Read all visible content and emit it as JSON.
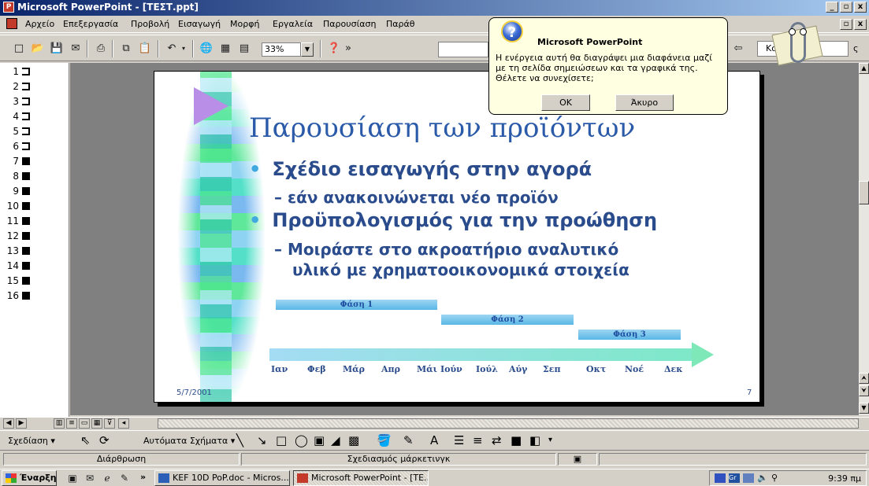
{
  "window": {
    "title": "Microsoft PowerPoint - [ΤΕΣΤ.ppt]",
    "min_btn": "_",
    "restore_btn": "▫",
    "close_btn": "x"
  },
  "menu": [
    {
      "label": "Αρχείο"
    },
    {
      "label": "Επεξεργασία"
    },
    {
      "label": "Προβολή"
    },
    {
      "label": "Εισαγωγή"
    },
    {
      "label": "Μορφή"
    },
    {
      "label": "Εργαλεία"
    },
    {
      "label": "Παρουσίαση"
    },
    {
      "label": "Παράθ"
    }
  ],
  "toolbar": {
    "zoom": "33%",
    "right_box": "Κο",
    "right_extra": "ς"
  },
  "outline": {
    "slides": [
      {
        "num": "1",
        "type": "outline"
      },
      {
        "num": "2",
        "type": "outline"
      },
      {
        "num": "3",
        "type": "outline"
      },
      {
        "num": "4",
        "type": "outline"
      },
      {
        "num": "5",
        "type": "outline"
      },
      {
        "num": "6",
        "type": "outline"
      },
      {
        "num": "7",
        "type": "filled"
      },
      {
        "num": "8",
        "type": "filled"
      },
      {
        "num": "9",
        "type": "filled"
      },
      {
        "num": "10",
        "type": "filled"
      },
      {
        "num": "11",
        "type": "filled"
      },
      {
        "num": "12",
        "type": "filled"
      },
      {
        "num": "13",
        "type": "filled"
      },
      {
        "num": "14",
        "type": "filled"
      },
      {
        "num": "15",
        "type": "filled"
      },
      {
        "num": "16",
        "type": "filled"
      }
    ]
  },
  "slide": {
    "title": "Παρουσίαση των προϊόντων",
    "bullet1": "Σχέδιο εισαγωγής στην αγορά",
    "sub1": "– εάν ανακοινώνεται νέο προϊόν",
    "bullet2": "Προϋπολογισμός για την προώθηση",
    "sub2_line1": "– Μοιράστε στο ακροατήριο αναλυτικό",
    "sub2_line2": "υλικό με χρηματοοικονομικά στοιχεία",
    "bullet_dot": "•",
    "phases": [
      "Φάση 1",
      "Φάση 2",
      "Φάση 3"
    ],
    "months": [
      "Ιαν",
      "Φεβ",
      "Μάρ",
      "Απρ",
      "Μάι",
      "Ιούν",
      "Ιούλ",
      "Αύγ",
      "Σεπ",
      "Οκτ",
      "Νοέ",
      "Δεκ"
    ],
    "date": "5/7/2001",
    "number": "7"
  },
  "dialog": {
    "title": "Microsoft PowerPoint",
    "message": "Η ενέργεια αυτή θα διαγράψει μια διαφάνεια μαζί με τη σελίδα σημειώσεων και τα γραφικά της. Θέλετε να συνεχίσετε;",
    "ok": "OK",
    "cancel": "Άκυρο",
    "icon": "?"
  },
  "drawing": {
    "draw_menu": "Σχεδίαση ▾",
    "autoshapes": "Αυτόματα Σχήματα ▾"
  },
  "status": {
    "view": "Διάρθρωση",
    "design": "Σχεδιασμός μάρκετινγκ"
  },
  "taskbar": {
    "start": "Έναρξη",
    "chevron": "»",
    "tasks": [
      {
        "label": "KEF 10D PoP.doc - Micros..."
      },
      {
        "label": "Microsoft PowerPoint - [TE..."
      }
    ],
    "clock": "9:39 πμ"
  },
  "colors": {
    "title_blue": "#2a5aa8",
    "body_blue": "#2b4c8c",
    "balloon": "#ffffe1",
    "titlebar_start": "#0a246a"
  }
}
